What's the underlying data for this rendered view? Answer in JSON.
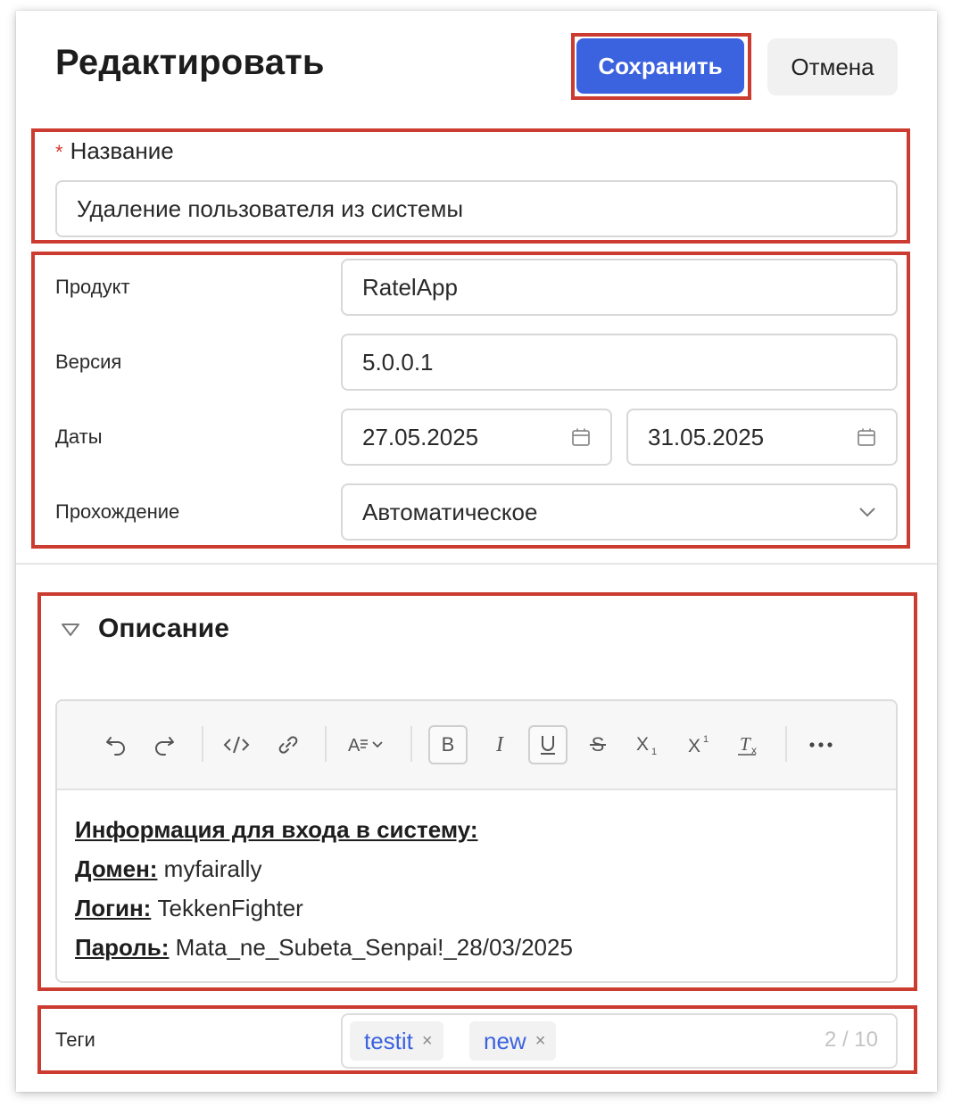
{
  "header": {
    "title": "Редактировать",
    "save_label": "Сохранить",
    "cancel_label": "Отмена"
  },
  "name_field": {
    "required_mark": "*",
    "label": "Название",
    "value": "Удаление пользователя из системы"
  },
  "attributes": {
    "product": {
      "label": "Продукт",
      "value": "RatelApp"
    },
    "version": {
      "label": "Версия",
      "value": "5.0.0.1"
    },
    "dates": {
      "label": "Даты",
      "start": "27.05.2025",
      "end": "31.05.2025"
    },
    "run_mode": {
      "label": "Прохождение",
      "value": "Автоматическое"
    }
  },
  "description": {
    "title": "Описание",
    "toolbar": [
      "undo-icon",
      "redo-icon",
      "code-icon",
      "link-icon",
      "font-size-icon",
      "bold-icon",
      "italic-icon",
      "underline-icon",
      "strikethrough-icon",
      "subscript-icon",
      "superscript-icon",
      "clear-format-icon",
      "more-icon"
    ],
    "content": {
      "heading": "Информация для входа в систему:",
      "lines": [
        {
          "key": "Домен:",
          "value": " myfairally"
        },
        {
          "key": "Логин:",
          "value": " TekkenFighter"
        },
        {
          "key": "Пароль:",
          "value": " Mata_ne_Subeta_Senpai!_28/03/2025"
        }
      ]
    }
  },
  "tags": {
    "label": "Теги",
    "items": [
      "testit",
      "new"
    ],
    "remove_glyph": "×",
    "counter": "2 / 10"
  },
  "colors": {
    "primary": "#3b62df",
    "required": "#d8352a",
    "highlight": "#cc3b30"
  }
}
